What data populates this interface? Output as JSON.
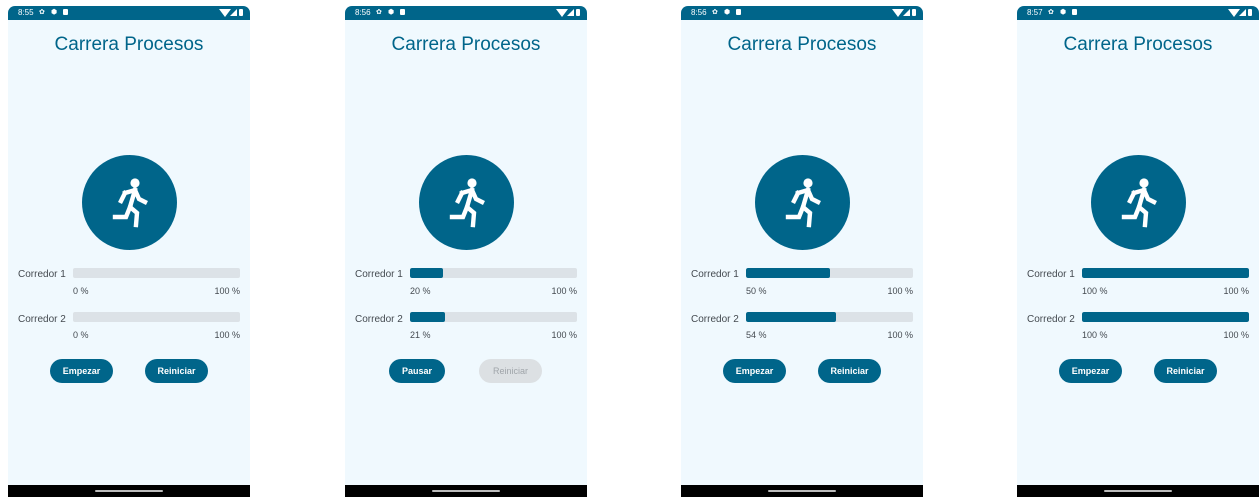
{
  "screens": [
    {
      "time": "8:55",
      "title": "Carrera Procesos",
      "runners": [
        {
          "label": "Corredor 1",
          "percent_text": "0 %",
          "max_text": "100 %",
          "progress": 0
        },
        {
          "label": "Corredor 2",
          "percent_text": "0 %",
          "max_text": "100 %",
          "progress": 0
        }
      ],
      "primary_button": {
        "label": "Empezar",
        "enabled": true
      },
      "secondary_button": {
        "label": "Reiniciar",
        "enabled": true
      }
    },
    {
      "time": "8:56",
      "title": "Carrera Procesos",
      "runners": [
        {
          "label": "Corredor 1",
          "percent_text": "20 %",
          "max_text": "100 %",
          "progress": 20
        },
        {
          "label": "Corredor 2",
          "percent_text": "21 %",
          "max_text": "100 %",
          "progress": 21
        }
      ],
      "primary_button": {
        "label": "Pausar",
        "enabled": true
      },
      "secondary_button": {
        "label": "Reiniciar",
        "enabled": false
      }
    },
    {
      "time": "8:56",
      "title": "Carrera Procesos",
      "runners": [
        {
          "label": "Corredor 1",
          "percent_text": "50 %",
          "max_text": "100 %",
          "progress": 50
        },
        {
          "label": "Corredor 2",
          "percent_text": "54 %",
          "max_text": "100 %",
          "progress": 54
        }
      ],
      "primary_button": {
        "label": "Empezar",
        "enabled": true
      },
      "secondary_button": {
        "label": "Reiniciar",
        "enabled": true
      }
    },
    {
      "time": "8:57",
      "title": "Carrera Procesos",
      "runners": [
        {
          "label": "Corredor 1",
          "percent_text": "100 %",
          "max_text": "100 %",
          "progress": 100
        },
        {
          "label": "Corredor 2",
          "percent_text": "100 %",
          "max_text": "100 %",
          "progress": 100
        }
      ],
      "primary_button": {
        "label": "Empezar",
        "enabled": true
      },
      "secondary_button": {
        "label": "Reiniciar",
        "enabled": true
      }
    }
  ],
  "icons": {
    "runner": "running-person-icon",
    "settings": "gear-icon",
    "security": "shield-icon",
    "notification": "document-icon",
    "wifi": "wifi-icon",
    "signal": "signal-icon",
    "battery": "battery-icon"
  },
  "colors": {
    "primary": "#00658a",
    "background": "#f0f9fe",
    "track": "#dce2e7",
    "disabled_button": "#dce0e3"
  }
}
